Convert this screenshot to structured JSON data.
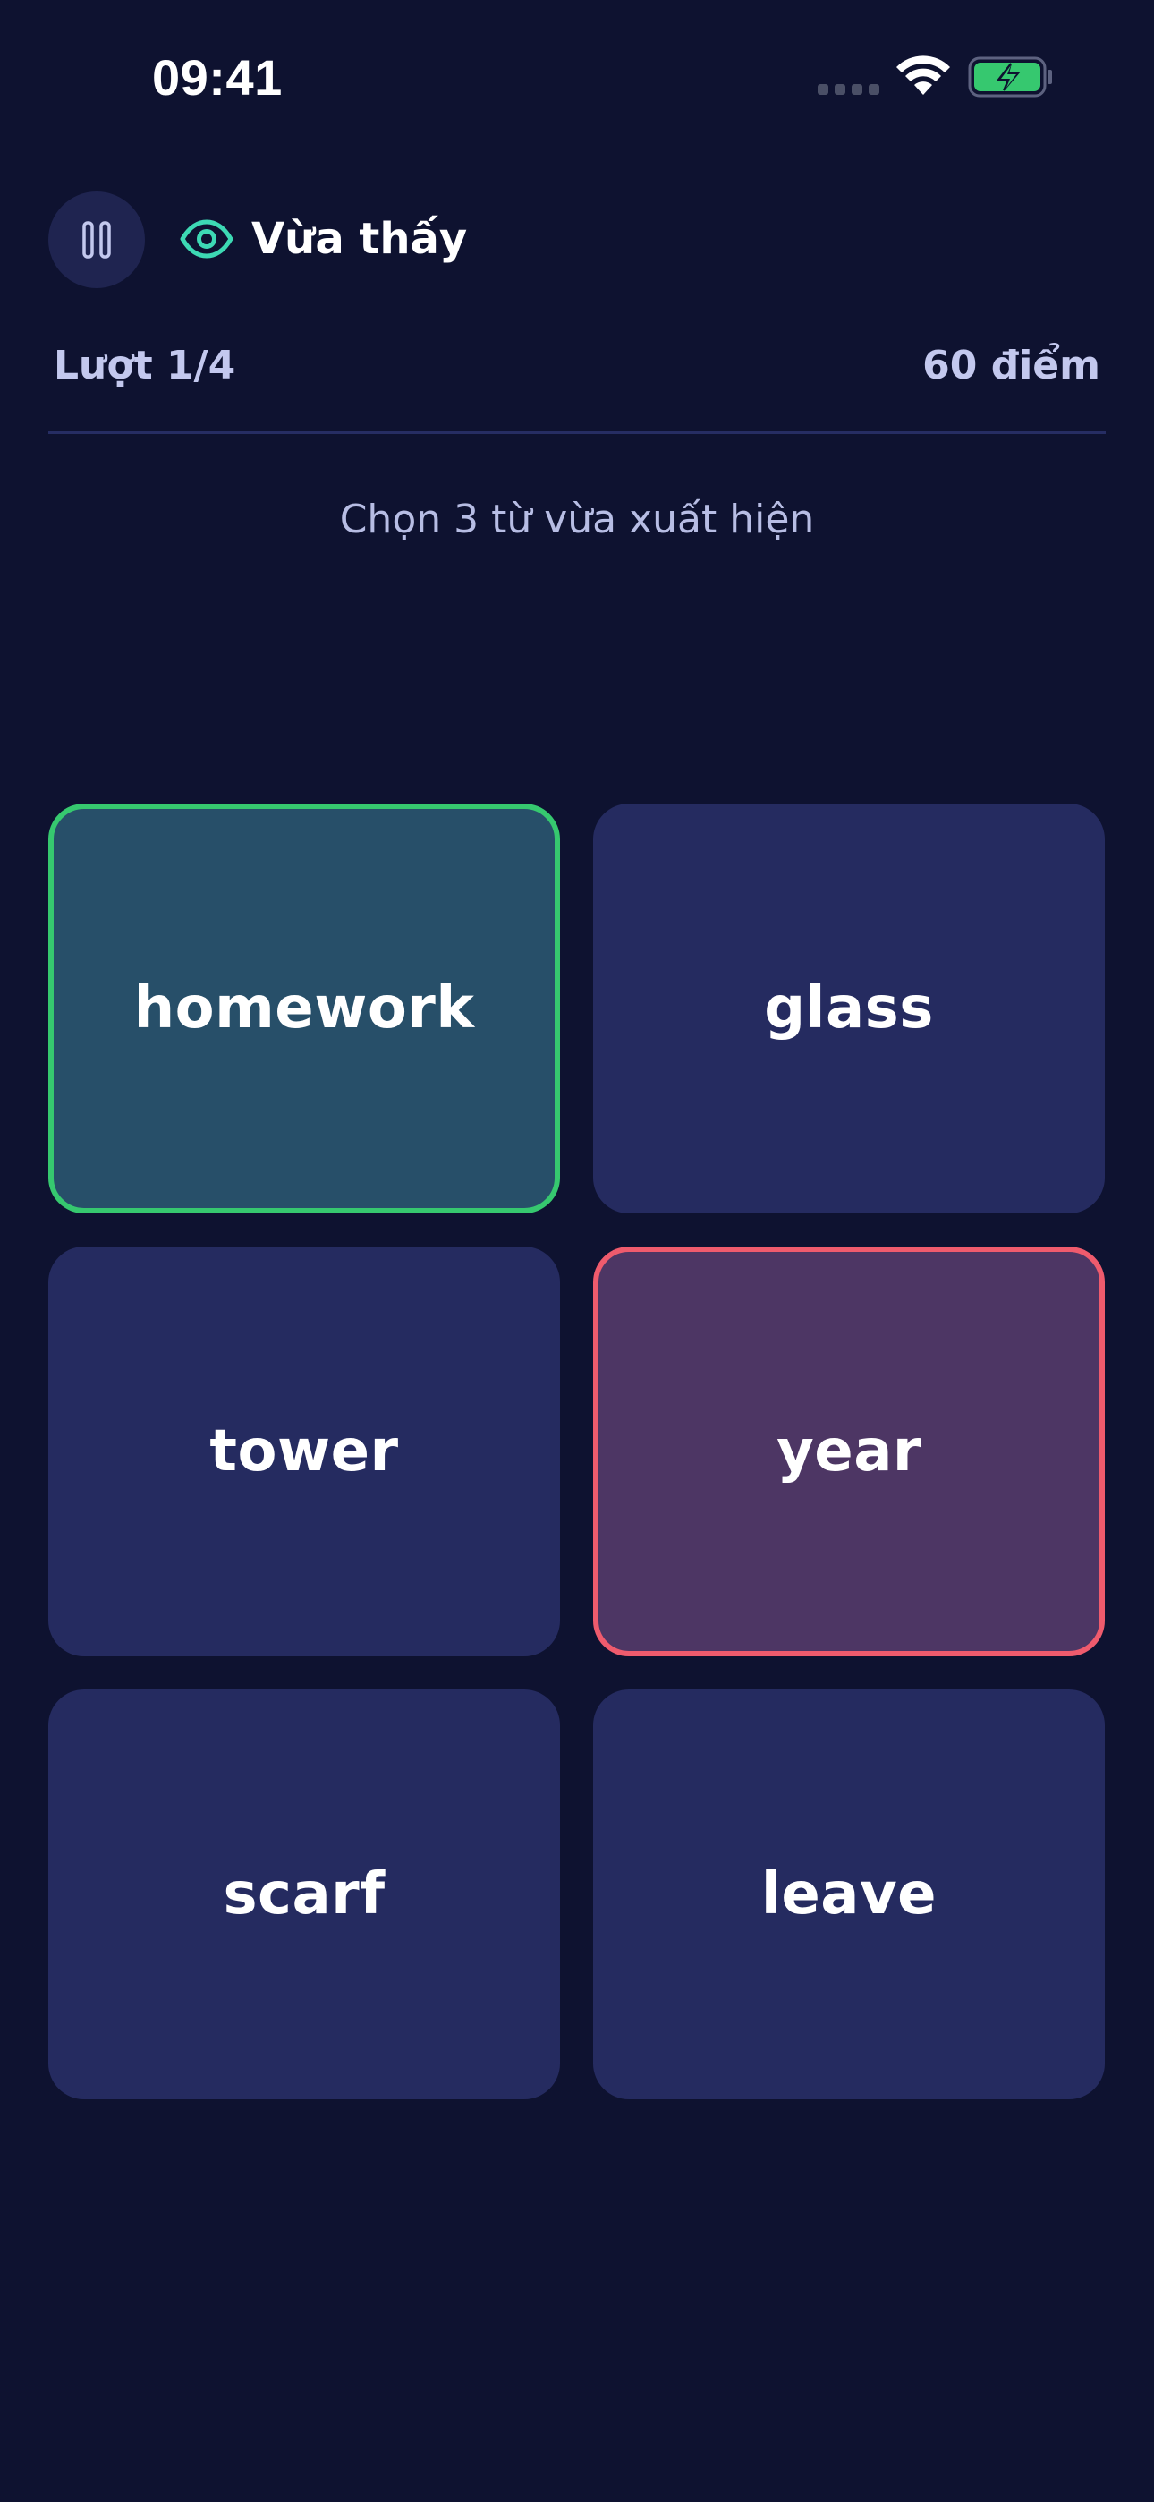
{
  "status_bar": {
    "time": "09:41",
    "icons": [
      "cellular-signal-icon",
      "wifi-icon",
      "battery-charging-icon"
    ],
    "battery_color": "#36c86f"
  },
  "header": {
    "pause_icon": "pause-icon",
    "mode_icon": "eye-icon",
    "mode_label": "Vừa thấy",
    "mode_icon_color": "#3dd9b4"
  },
  "progress": {
    "round_label": "Lượt 1/4",
    "score_label": "60 điểm"
  },
  "instruction": "Chọn 3 từ vừa xuất hiện",
  "words": [
    {
      "text": "homework",
      "state": "correct"
    },
    {
      "text": "glass",
      "state": "default"
    },
    {
      "text": "tower",
      "state": "default"
    },
    {
      "text": "year",
      "state": "wrong"
    },
    {
      "text": "scarf",
      "state": "default"
    },
    {
      "text": "leave",
      "state": "default"
    }
  ],
  "colors": {
    "background": "#0e1230",
    "card": "#252b60",
    "correct_border": "#36c86f",
    "wrong_border": "#ef5b6d"
  }
}
